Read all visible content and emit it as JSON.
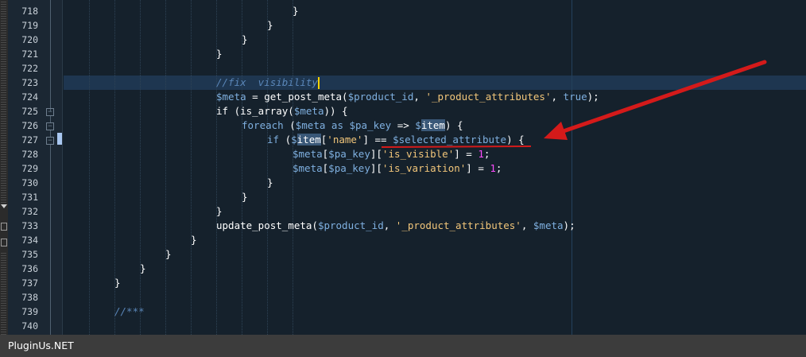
{
  "editor": {
    "lines": [
      {
        "num": "718",
        "indent": 9,
        "tokens": [
          {
            "t": "}",
            "c": "plain"
          }
        ]
      },
      {
        "num": "719",
        "indent": 8,
        "tokens": [
          {
            "t": "}",
            "c": "plain"
          }
        ]
      },
      {
        "num": "720",
        "indent": 7,
        "tokens": [
          {
            "t": "}",
            "c": "plain"
          }
        ]
      },
      {
        "num": "721",
        "indent": 6,
        "tokens": [
          {
            "t": "}",
            "c": "plain"
          }
        ]
      },
      {
        "num": "722",
        "indent": 0,
        "tokens": []
      },
      {
        "num": "723",
        "indent": 6,
        "tokens": [
          {
            "t": "//fix  visibility",
            "c": "cmt"
          }
        ]
      },
      {
        "num": "724",
        "indent": 6,
        "tokens": [
          {
            "t": "$meta",
            "c": "var"
          },
          {
            "t": " = get_post_meta(",
            "c": "plain"
          },
          {
            "t": "$product_id",
            "c": "var"
          },
          {
            "t": ", ",
            "c": "plain"
          },
          {
            "t": "'_product_attributes'",
            "c": "str"
          },
          {
            "t": ", ",
            "c": "plain"
          },
          {
            "t": "true",
            "c": "kw"
          },
          {
            "t": ");",
            "c": "plain"
          }
        ]
      },
      {
        "num": "725",
        "indent": 6,
        "tokens": [
          {
            "t": "if (is_array(",
            "c": "plain"
          },
          {
            "t": "$meta",
            "c": "var"
          },
          {
            "t": ")) {",
            "c": "plain"
          }
        ]
      },
      {
        "num": "726",
        "indent": 7,
        "tokens": [
          {
            "t": "foreach",
            "c": "kw"
          },
          {
            "t": " (",
            "c": "plain"
          },
          {
            "t": "$meta",
            "c": "var"
          },
          {
            "t": " as ",
            "c": "kw"
          },
          {
            "t": "$pa_key",
            "c": "var"
          },
          {
            "t": " => ",
            "c": "plain"
          },
          {
            "t": "$",
            "c": "var"
          },
          {
            "t": "item",
            "c": "hl"
          },
          {
            "t": ") {",
            "c": "plain"
          }
        ]
      },
      {
        "num": "727",
        "indent": 8,
        "tokens": [
          {
            "t": "if",
            "c": "kw"
          },
          {
            "t": " (",
            "c": "plain"
          },
          {
            "t": "$",
            "c": "var"
          },
          {
            "t": "item",
            "c": "hl"
          },
          {
            "t": "[",
            "c": "plain"
          },
          {
            "t": "'name'",
            "c": "str"
          },
          {
            "t": "] == ",
            "c": "plain"
          },
          {
            "t": "$selected_attribute",
            "c": "var"
          },
          {
            "t": ") {",
            "c": "plain"
          }
        ]
      },
      {
        "num": "728",
        "indent": 9,
        "tokens": [
          {
            "t": "$meta",
            "c": "var"
          },
          {
            "t": "[",
            "c": "plain"
          },
          {
            "t": "$pa_key",
            "c": "var"
          },
          {
            "t": "][",
            "c": "plain"
          },
          {
            "t": "'is_visible'",
            "c": "str"
          },
          {
            "t": "] = ",
            "c": "plain"
          },
          {
            "t": "1",
            "c": "num"
          },
          {
            "t": ";",
            "c": "plain"
          }
        ]
      },
      {
        "num": "729",
        "indent": 9,
        "tokens": [
          {
            "t": "$meta",
            "c": "var"
          },
          {
            "t": "[",
            "c": "plain"
          },
          {
            "t": "$pa_key",
            "c": "var"
          },
          {
            "t": "][",
            "c": "plain"
          },
          {
            "t": "'is_variation'",
            "c": "str"
          },
          {
            "t": "] = ",
            "c": "plain"
          },
          {
            "t": "1",
            "c": "num"
          },
          {
            "t": ";",
            "c": "plain"
          }
        ]
      },
      {
        "num": "730",
        "indent": 8,
        "tokens": [
          {
            "t": "}",
            "c": "plain"
          }
        ]
      },
      {
        "num": "731",
        "indent": 7,
        "tokens": [
          {
            "t": "}",
            "c": "plain"
          }
        ]
      },
      {
        "num": "732",
        "indent": 6,
        "tokens": [
          {
            "t": "}",
            "c": "plain"
          }
        ]
      },
      {
        "num": "733",
        "indent": 6,
        "tokens": [
          {
            "t": "update_post_meta(",
            "c": "plain"
          },
          {
            "t": "$product_id",
            "c": "var"
          },
          {
            "t": ", ",
            "c": "plain"
          },
          {
            "t": "'_product_attributes'",
            "c": "str"
          },
          {
            "t": ", ",
            "c": "plain"
          },
          {
            "t": "$meta",
            "c": "var"
          },
          {
            "t": ");",
            "c": "plain"
          }
        ]
      },
      {
        "num": "734",
        "indent": 5,
        "tokens": [
          {
            "t": "}",
            "c": "plain"
          }
        ]
      },
      {
        "num": "735",
        "indent": 4,
        "tokens": [
          {
            "t": "}",
            "c": "plain"
          }
        ]
      },
      {
        "num": "736",
        "indent": 3,
        "tokens": [
          {
            "t": "}",
            "c": "plain"
          }
        ]
      },
      {
        "num": "737",
        "indent": 2,
        "tokens": [
          {
            "t": "}",
            "c": "plain"
          }
        ]
      },
      {
        "num": "738",
        "indent": 0,
        "tokens": []
      },
      {
        "num": "739",
        "indent": 2,
        "tokens": [
          {
            "t": "//***",
            "c": "cmt"
          }
        ]
      },
      {
        "num": "740",
        "indent": 0,
        "tokens": []
      }
    ],
    "colors": {
      "background": "#15212c",
      "current_line": "#1e3650",
      "variable": "#7fb0e0",
      "string": "#f2c67a",
      "number": "#ff4cff",
      "comment": "#5a86b8",
      "annotation": "#d41a1a"
    },
    "icons": [
      "fold-collapse-icon",
      "red-arrow-icon"
    ]
  },
  "footer": {
    "watermark": "PluginUs.NET"
  }
}
